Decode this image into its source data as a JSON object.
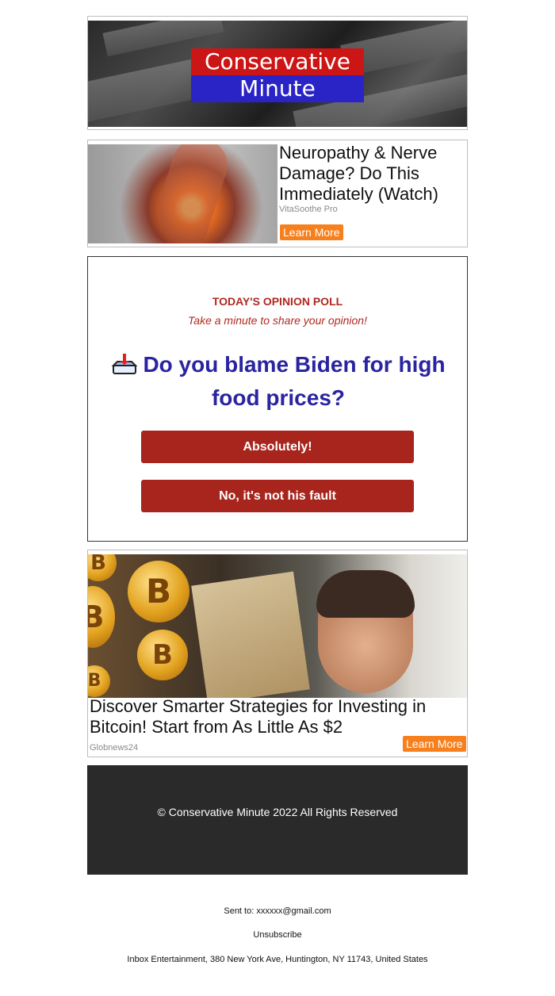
{
  "header": {
    "logo_line1": "Conservative",
    "logo_line2": "Minute"
  },
  "ad_top": {
    "title": "Neuropathy & Nerve Damage? Do This Immediately (Watch)",
    "source": "VitaSoothe Pro",
    "cta": "Learn More"
  },
  "poll": {
    "kicker": "TODAY'S OPINION POLL",
    "subtitle": "Take a minute to share your opinion!",
    "question": "Do you blame Biden for high food prices?",
    "icon": "ballot-box-icon",
    "options": [
      "Absolutely!",
      "No, it's not his fault"
    ]
  },
  "ad_bottom": {
    "title": "Discover Smarter Strategies for Investing in Bitcoin! Start from As Little As $2",
    "source": "Globnews24",
    "cta": "Learn More"
  },
  "footer": {
    "copyright": "© Conservative Minute 2022 All Rights Reserved"
  },
  "meta": {
    "sent_to_label": "Sent to:",
    "sent_to_email": "xxxxxx@gmail.com",
    "unsubscribe": "Unsubscribe",
    "address": "Inbox Entertainment, 380 New York Ave, Huntington, NY 11743, United States"
  },
  "colors": {
    "logo_red": "#cc1616",
    "logo_blue": "#2a24c6",
    "poll_red": "#a8251d",
    "poll_question_blue": "#2a24a0",
    "cta_orange": "#f7801e",
    "footer_bg": "#2a2a2a"
  }
}
